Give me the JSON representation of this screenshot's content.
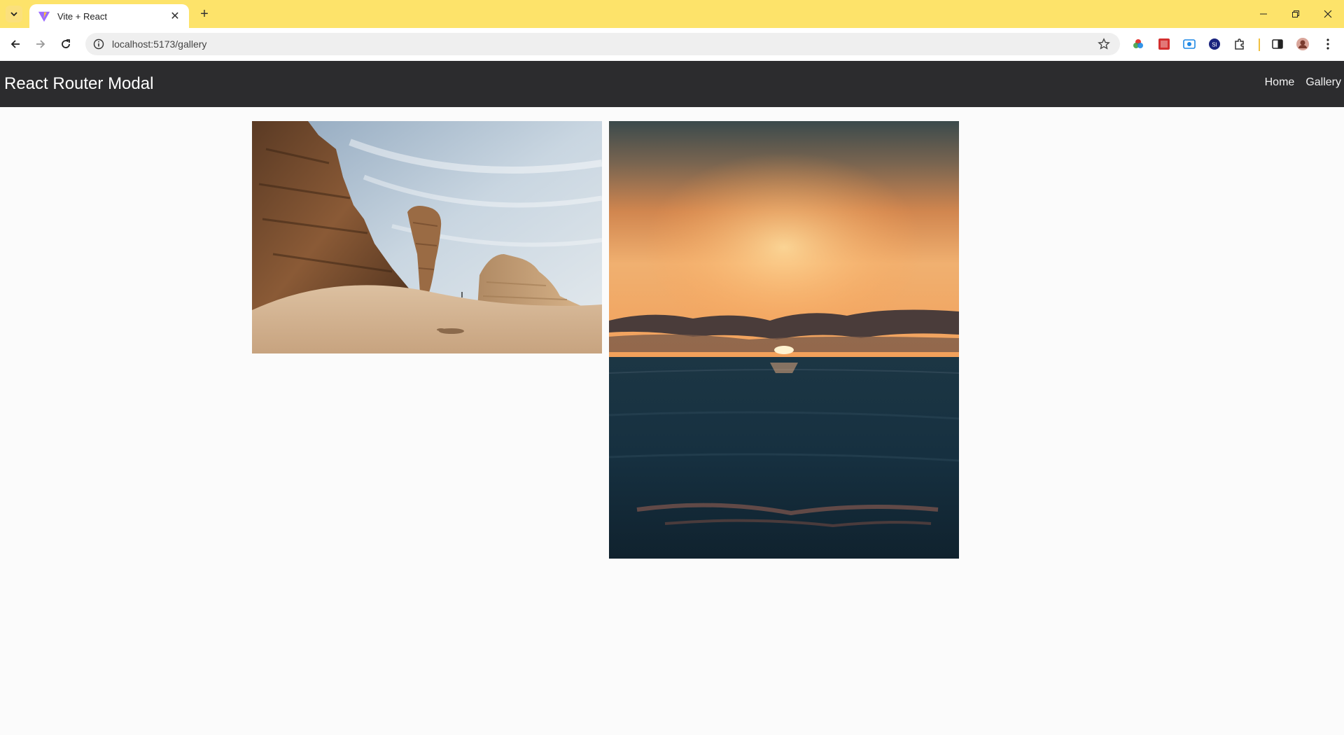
{
  "browser": {
    "tab": {
      "title": "Vite + React",
      "favicon": "vite-logo-icon"
    },
    "address": {
      "url": "localhost:5173/gallery"
    },
    "extensions": [
      "color-wheel-icon",
      "red-extension-icon",
      "camera-extension-icon",
      "si-badge-icon",
      "puzzle-icon",
      "side-panel-icon",
      "profile-avatar-icon",
      "kebab-menu-icon"
    ]
  },
  "app": {
    "brand": "React Router Modal",
    "nav": [
      {
        "label": "Home"
      },
      {
        "label": "Gallery"
      }
    ]
  },
  "gallery": {
    "images": [
      {
        "subject": "desert-rock-formations-image"
      },
      {
        "subject": "ocean-sunset-image"
      }
    ]
  },
  "colors": {
    "tabbar": "#fde36a",
    "navbar": "#2c2c2e",
    "page": "#fbfbfb"
  }
}
